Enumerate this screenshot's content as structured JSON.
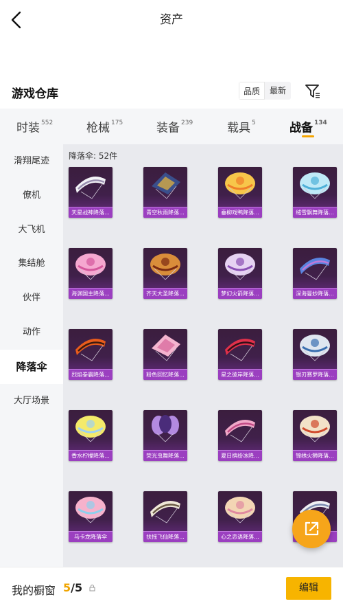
{
  "header": {
    "title": "资产"
  },
  "warehouse": {
    "title": "游戏仓库",
    "sort_options": [
      {
        "label": "品质",
        "active": true
      },
      {
        "label": "最新",
        "active": false
      }
    ]
  },
  "tabs": [
    {
      "label": "时装",
      "count": "552"
    },
    {
      "label": "枪械",
      "count": "175"
    },
    {
      "label": "装备",
      "count": "239"
    },
    {
      "label": "载具",
      "count": "5"
    },
    {
      "label": "战备",
      "count": "134",
      "active": true
    }
  ],
  "sidebar": [
    {
      "label": "滑翔尾迹"
    },
    {
      "label": "僚机"
    },
    {
      "label": "大飞机"
    },
    {
      "label": "集结舱"
    },
    {
      "label": "伙伴"
    },
    {
      "label": "动作"
    },
    {
      "label": "降落伞",
      "active": true
    },
    {
      "label": "大厅场景"
    }
  ],
  "content": {
    "count_label": "降落伞: 52件",
    "items": [
      {
        "label": "天星战神降落...",
        "c1": "#f2f2f6",
        "c2": "#9a8fb0",
        "shape": "wing"
      },
      {
        "label": "青空秋雨降落...",
        "c1": "#3a4f8c",
        "c2": "#e0b040",
        "shape": "square"
      },
      {
        "label": "垂柳戏鸭降落...",
        "c1": "#f7c64a",
        "c2": "#ef7d2a",
        "shape": "dome"
      },
      {
        "label": "绒雪飘舞降落...",
        "c1": "#bfe9f7",
        "c2": "#4fb0d8",
        "shape": "dome"
      },
      {
        "label": "海渊国主降落...",
        "c1": "#f5a8d0",
        "c2": "#d4579c",
        "shape": "dome"
      },
      {
        "label": "齐天大圣降落...",
        "c1": "#d98d3a",
        "c2": "#7a2a12",
        "shape": "dome"
      },
      {
        "label": "梦幻火箭降落...",
        "c1": "#e6d2f2",
        "c2": "#8a4fb4",
        "shape": "dome"
      },
      {
        "label": "深海曼妙降落...",
        "c1": "#5a84e0",
        "c2": "#c07ad8",
        "shape": "wing"
      },
      {
        "label": "烈焰拳霸降落...",
        "c1": "#e85c1c",
        "c2": "#3a1a10",
        "shape": "wing"
      },
      {
        "label": "粉色回忆降落...",
        "c1": "#f4b4cf",
        "c2": "#d86a9c",
        "shape": "square"
      },
      {
        "label": "星之彼岸降落...",
        "c1": "#e0304a",
        "c2": "#301018",
        "shape": "wing"
      },
      {
        "label": "银刃赛罗降落...",
        "c1": "#dfe6f0",
        "c2": "#3a6fb0",
        "shape": "dome"
      },
      {
        "label": "香水柠檬降落...",
        "c1": "#f4ea6a",
        "c2": "#9ed0f2",
        "shape": "dome"
      },
      {
        "label": "荧光虫舞降落...",
        "c1": "#b38ae0",
        "c2": "#4a2c7a",
        "shape": "bloom"
      },
      {
        "label": "夏日缤纷冰降...",
        "c1": "#f0a8c8",
        "c2": "#c24a86",
        "shape": "wing"
      },
      {
        "label": "锦绣火狮降落...",
        "c1": "#f2e2c8",
        "c2": "#d04a2c",
        "shape": "dome"
      },
      {
        "label": "马卡龙降落伞",
        "c1": "#f7b2cc",
        "c2": "#8ed0ec",
        "shape": "dome"
      },
      {
        "label": "扶摇飞仙降落...",
        "c1": "#f0e8d8",
        "c2": "#6a5a44",
        "shape": "wing"
      },
      {
        "label": "心之恋语降落...",
        "c1": "#f3d6b4",
        "c2": "#e08aa0",
        "shape": "dome"
      },
      {
        "label": "",
        "c1": "#f0f0f4",
        "c2": "#7a8ab0",
        "shape": "wing"
      }
    ]
  },
  "fab": {
    "icon": "share-icon"
  },
  "showcase": {
    "label": "我的橱窗",
    "current": "5",
    "total": "/5",
    "edit_label": "编辑"
  }
}
